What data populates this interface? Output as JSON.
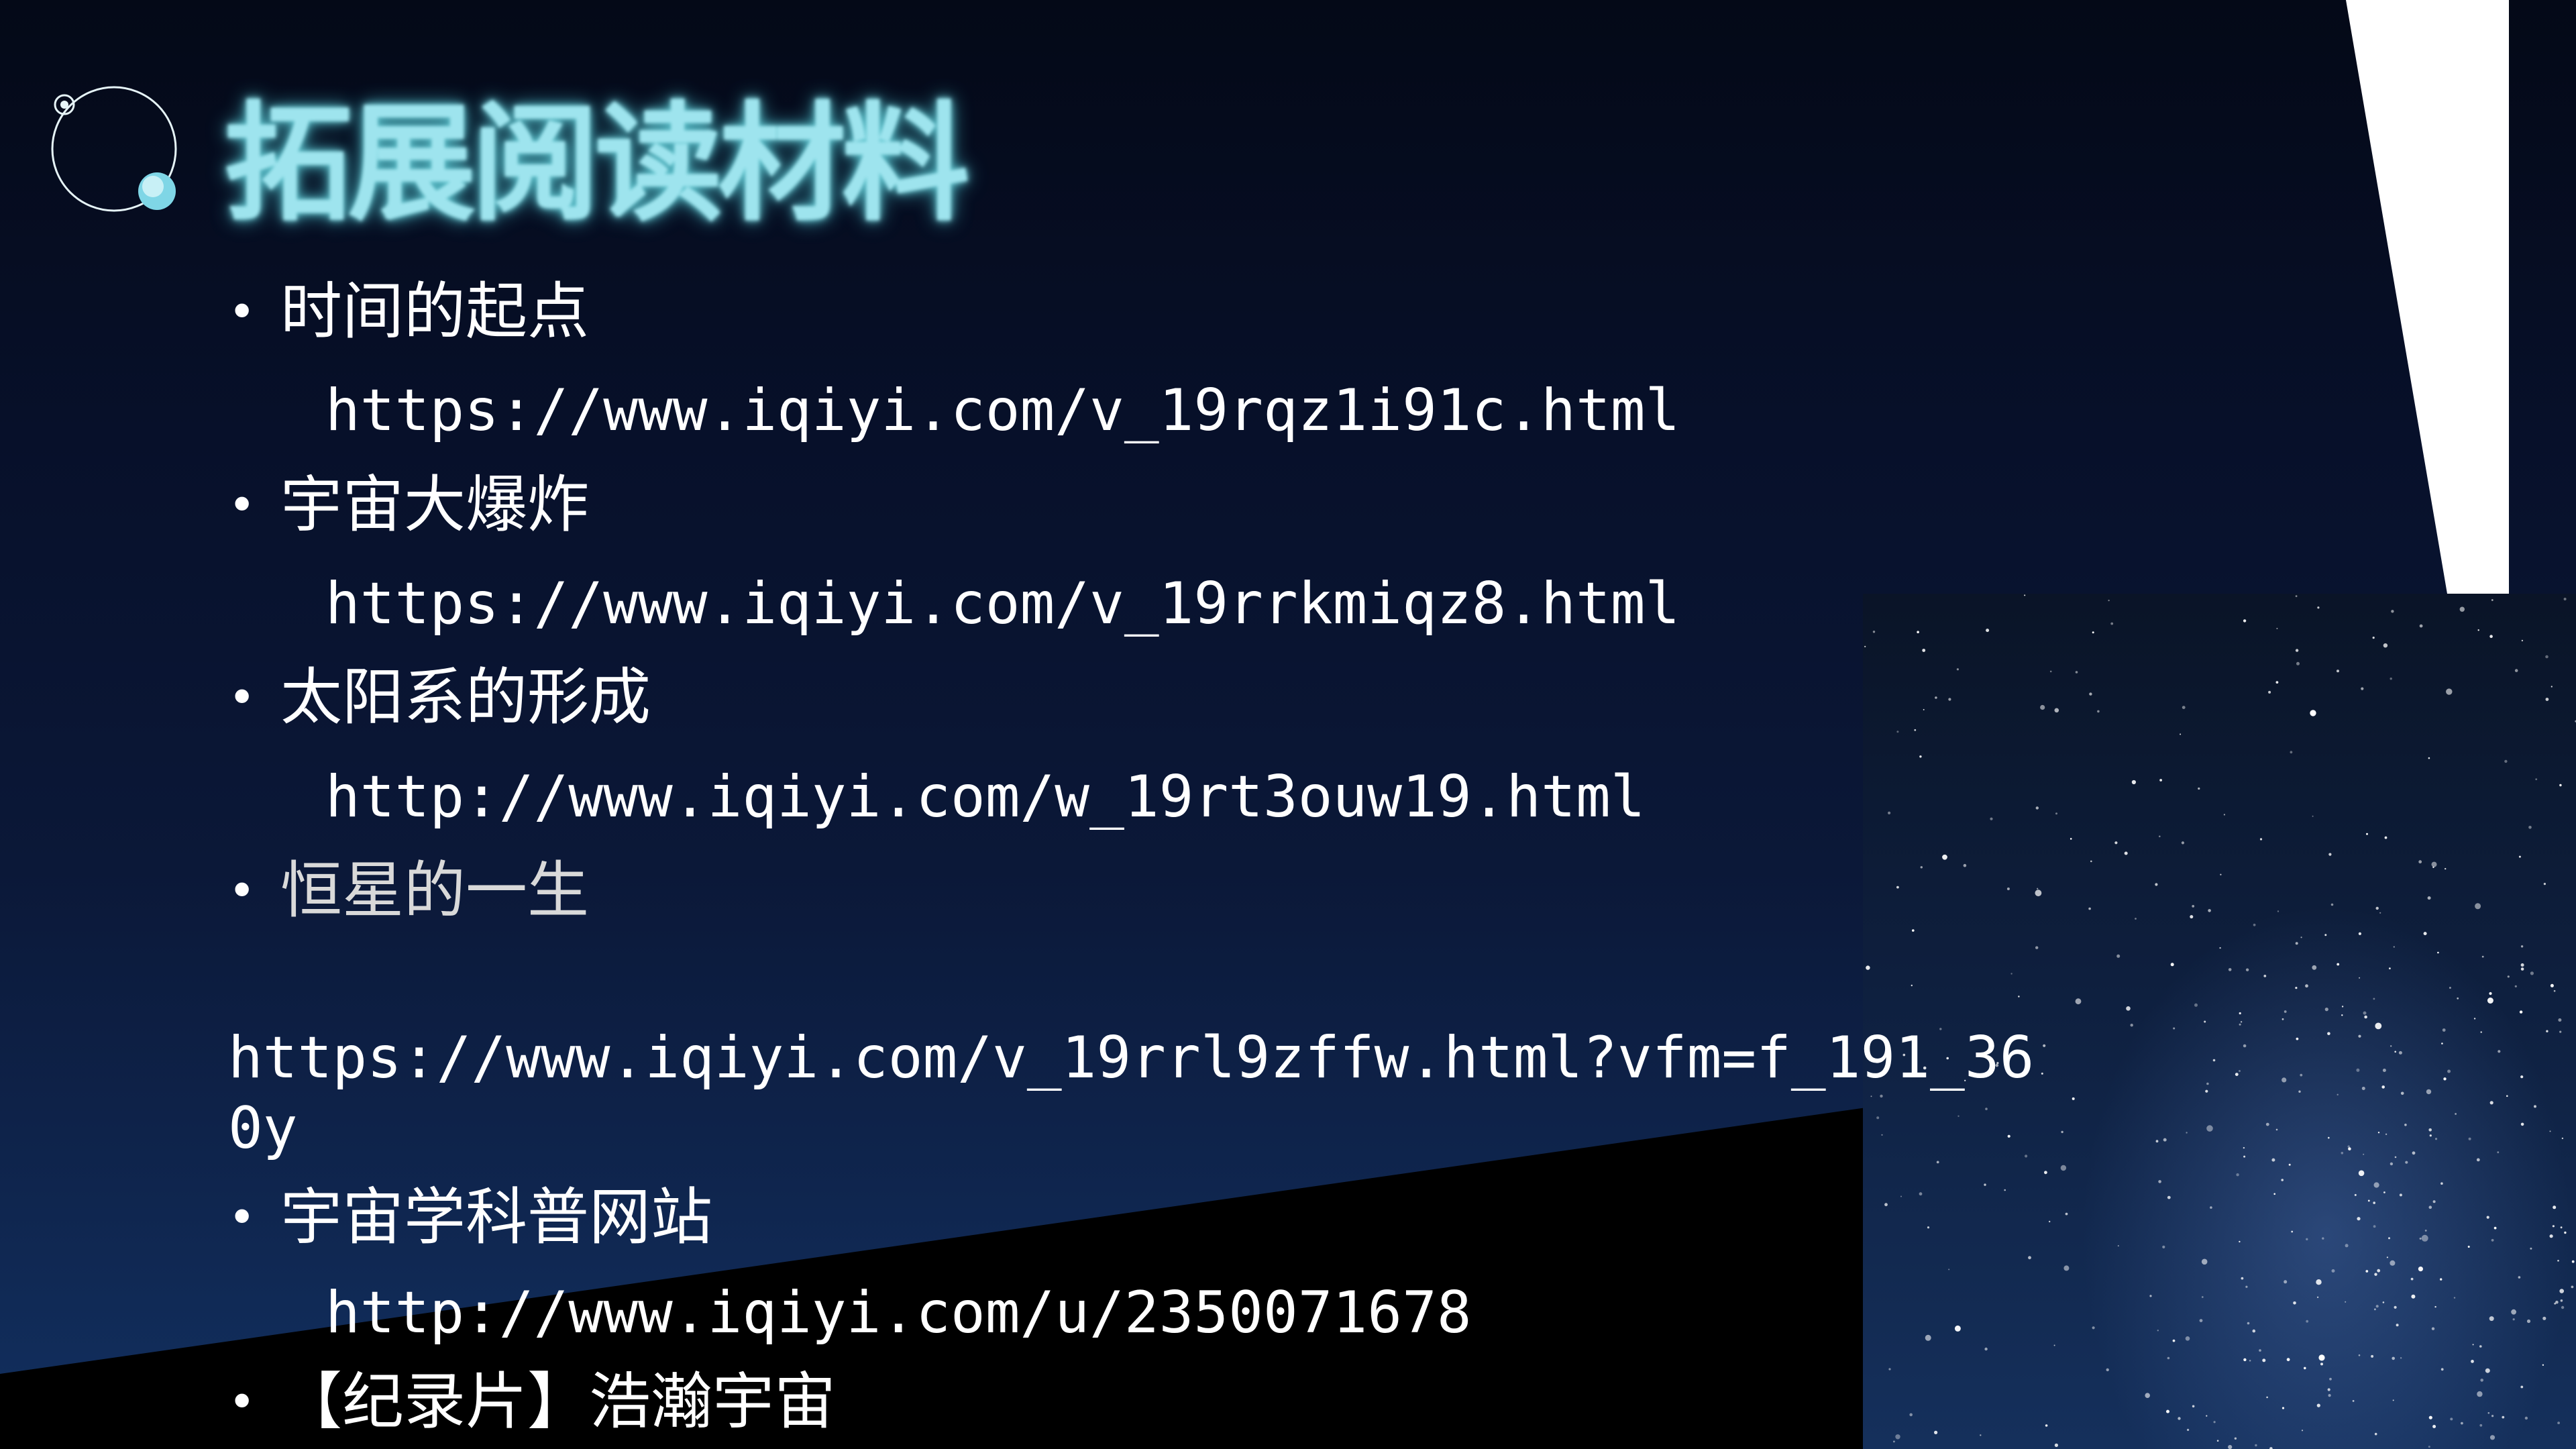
{
  "slide": {
    "title": "拓展阅读材料",
    "items": [
      {
        "label": "时间的起点",
        "url": "https://www.iqiyi.com/v_19rqz1i91c.html"
      },
      {
        "label": "宇宙大爆炸",
        "url": "https://www.iqiyi.com/v_19rrkmiqz8.html"
      },
      {
        "label": "太阳系的形成",
        "url": "http://www.iqiyi.com/w_19rt3ouw19.html"
      },
      {
        "label": "恒星的一生",
        "url_line1": "https://www.iqiyi.com/v_19rrl9zffw.html?vfm=f_191_36",
        "url_line2": "0y"
      },
      {
        "label": "宇宙学科普网站",
        "url": "http://www.iqiyi.com/u/2350071678"
      },
      {
        "label": "【纪录片】浩瀚宇宙"
      }
    ],
    "bullet": "•"
  },
  "colors": {
    "background": "#07102a",
    "title_glow": "#9ee4ee",
    "text": "#ffffff"
  },
  "icons": {
    "logo": "orbit-rings-icon"
  }
}
